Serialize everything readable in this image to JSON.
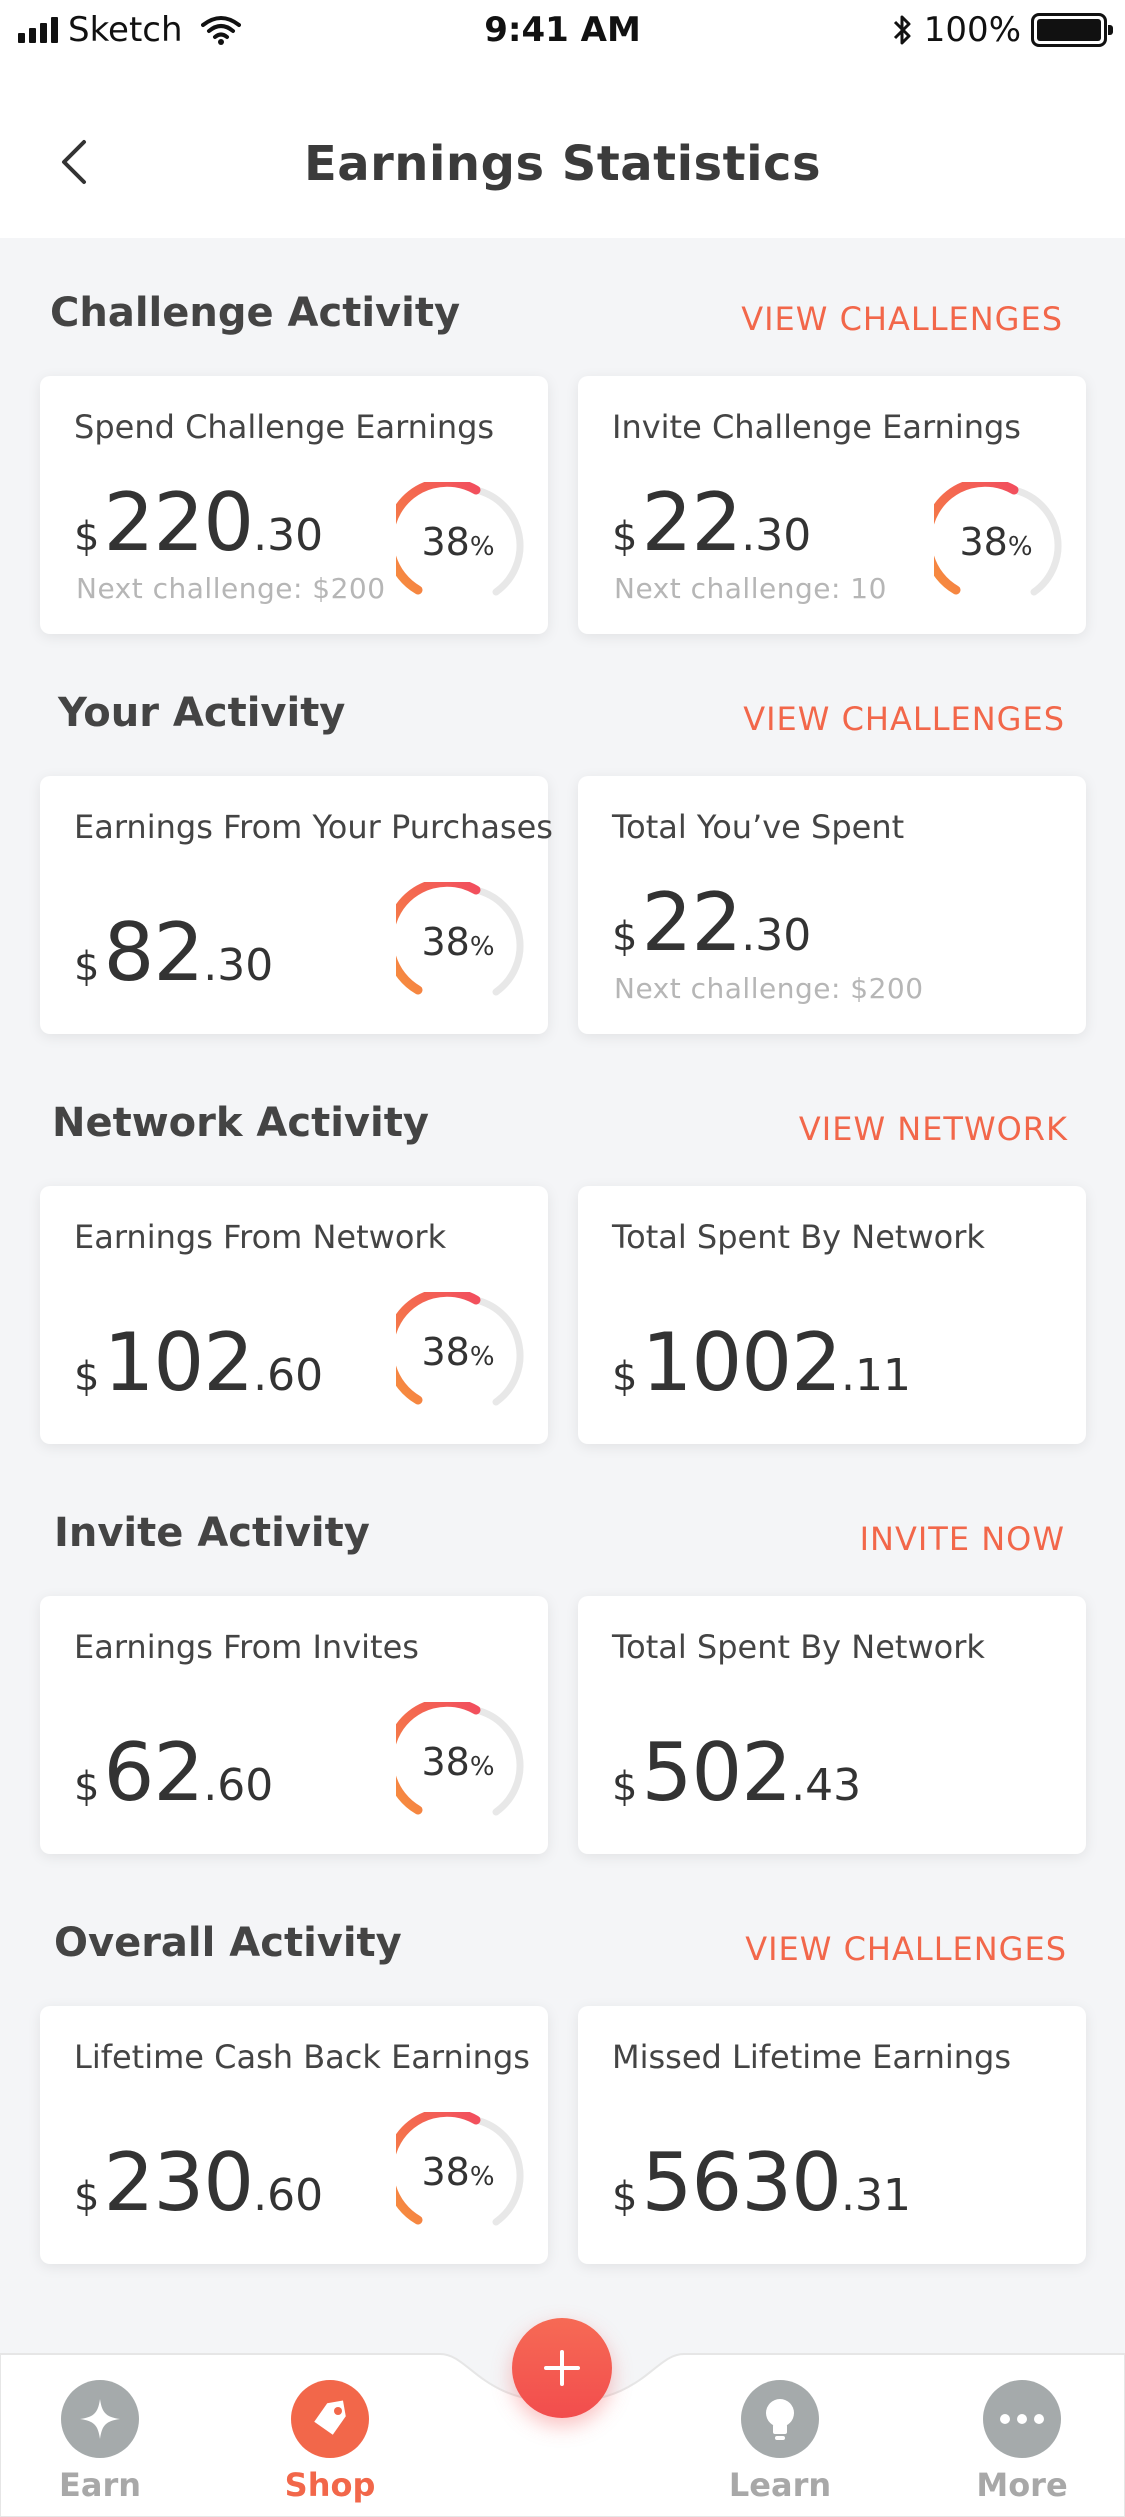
{
  "status_bar": {
    "carrier": "Sketch",
    "time": "9:41 AM",
    "battery": "100%",
    "icons": [
      "signal-icon",
      "wifi-icon",
      "bluetooth-icon",
      "battery-icon"
    ]
  },
  "header": {
    "title": "Earnings Statistics",
    "back_icon": "chevron-left-icon"
  },
  "accent_color": "#f2674a",
  "sections": [
    {
      "title": "Challenge Activity",
      "link": "VIEW CHALLENGES",
      "cards": [
        {
          "label": "Spend Challenge Earnings",
          "currency": "$",
          "whole": "220",
          "decimal": ".30",
          "note": "Next challenge: $200",
          "gauge_pct": "38",
          "gauge_unit": "%"
        },
        {
          "label": "Invite Challenge Earnings",
          "currency": "$",
          "whole": "22",
          "decimal": ".30",
          "note": "Next challenge: 10",
          "gauge_pct": "38",
          "gauge_unit": "%"
        }
      ]
    },
    {
      "title": "Your Activity",
      "link": "VIEW CHALLENGES",
      "cards": [
        {
          "label": "Earnings From Your Purchases",
          "currency": "$",
          "whole": "82",
          "decimal": ".30",
          "gauge_pct": "38",
          "gauge_unit": "%"
        },
        {
          "label": "Total You’ve Spent",
          "currency": "$",
          "whole": "22",
          "decimal": ".30",
          "note": "Next challenge: $200"
        }
      ]
    },
    {
      "title": "Network Activity",
      "link": "VIEW NETWORK",
      "cards": [
        {
          "label": "Earnings From Network",
          "currency": "$",
          "whole": "102",
          "decimal": ".60",
          "gauge_pct": "38",
          "gauge_unit": "%"
        },
        {
          "label": "Total Spent By Network",
          "currency": "$",
          "whole": "1002",
          "decimal": ".11"
        }
      ]
    },
    {
      "title": "Invite Activity",
      "link": "INVITE NOW",
      "cards": [
        {
          "label": "Earnings From Invites",
          "currency": "$",
          "whole": "62",
          "decimal": ".60",
          "gauge_pct": "38",
          "gauge_unit": "%"
        },
        {
          "label": "Total Spent By Network",
          "currency": "$",
          "whole": "502",
          "decimal": ".43"
        }
      ]
    },
    {
      "title": "Overall Activity",
      "link": "VIEW CHALLENGES",
      "cards": [
        {
          "label": "Lifetime Cash Back Earnings",
          "currency": "$",
          "whole": "230",
          "decimal": ".60",
          "gauge_pct": "38",
          "gauge_unit": "%"
        },
        {
          "label": "Missed Lifetime Earnings",
          "currency": "$",
          "whole": "5630",
          "decimal": ".31"
        }
      ]
    }
  ],
  "tabbar": {
    "tabs": [
      {
        "label": "Earn",
        "icon": "sparkle-icon",
        "active": false
      },
      {
        "label": "Shop",
        "icon": "tag-icon",
        "active": true
      },
      {
        "label": "Learn",
        "icon": "lightbulb-icon",
        "active": false
      },
      {
        "label": "More",
        "icon": "more-dots-icon",
        "active": false
      }
    ],
    "fab_icon": "plus-icon"
  }
}
